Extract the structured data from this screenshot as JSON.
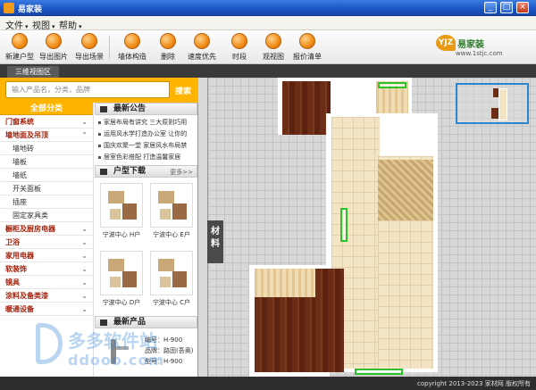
{
  "window": {
    "title": "易家装"
  },
  "menu": [
    {
      "label": "文件"
    },
    {
      "label": "视图"
    },
    {
      "label": "帮助"
    }
  ],
  "toolbar": {
    "tools": [
      {
        "label": "新建户型",
        "icon": "new-floorplan-icon"
      },
      {
        "label": "导出图片",
        "icon": "export-image-icon"
      },
      {
        "label": "导出场景",
        "icon": "export-scene-icon"
      },
      {
        "label": "墙体构造",
        "icon": "wall-structure-icon"
      },
      {
        "label": "删除",
        "icon": "delete-icon"
      },
      {
        "label": "速度优先",
        "icon": "speed-priority-icon"
      },
      {
        "label": "时段",
        "icon": "time-period-icon"
      },
      {
        "label": "观视图",
        "icon": "view-icon"
      },
      {
        "label": "报价清单",
        "icon": "quote-list-icon"
      }
    ],
    "brand": {
      "mark": "YJZ",
      "name": "易家装",
      "url": "www.1stjc.com"
    }
  },
  "tabs": [
    {
      "label": "三维视图区"
    }
  ],
  "search": {
    "placeholder": "输入产品名，分类，品牌",
    "button": "搜索"
  },
  "categories": {
    "header": "全部分类",
    "items": [
      {
        "label": "门窗系统",
        "level": "main"
      },
      {
        "label": "墙地面及吊顶",
        "level": "main"
      },
      {
        "label": "墙地砖",
        "level": "sub"
      },
      {
        "label": "墙板",
        "level": "sub"
      },
      {
        "label": "墙纸",
        "level": "sub"
      },
      {
        "label": "开关面板",
        "level": "sub"
      },
      {
        "label": "插座",
        "level": "sub"
      },
      {
        "label": "固定家具类",
        "level": "sub"
      },
      {
        "label": "橱柜及厨房电器",
        "level": "main"
      },
      {
        "label": "卫浴",
        "level": "main"
      },
      {
        "label": "家用电器",
        "level": "main"
      },
      {
        "label": "软装饰",
        "level": "main"
      },
      {
        "label": "镜具",
        "level": "main"
      },
      {
        "label": "涂料及备类漆",
        "level": "main"
      },
      {
        "label": "暖通设备",
        "level": "main"
      }
    ]
  },
  "announcements": {
    "title": "最新公告",
    "items": [
      "家居布局有讲究 三大原则巧用",
      "运用风水学打造办公室 让你的",
      "国庆欢聚一堂 家居风水布局禁",
      "居室色彩搭配 打造温馨家居"
    ]
  },
  "floorplans": {
    "title": "户型下载",
    "more": "更多>>",
    "items": [
      {
        "caption": "宁波中心 H户"
      },
      {
        "caption": "宁波中心 E户"
      },
      {
        "caption": "宁波中心 D户"
      },
      {
        "caption": "宁波中心 C户"
      }
    ]
  },
  "products": {
    "title": "最新产品",
    "lines": [
      "编号：H-900",
      "品牌：路固(吾奥)",
      "型号：H-900"
    ]
  },
  "material_tab": {
    "label": "材料"
  },
  "watermark": {
    "line1": "多多软件站",
    "line2": "ddooo.com"
  },
  "status": {
    "copyright": "copyright 2013-2023 家材网 版权所有"
  }
}
